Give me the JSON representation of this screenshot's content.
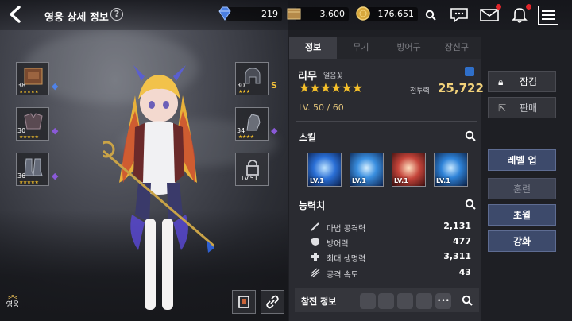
{
  "header": {
    "title": "영웅 상세 정보",
    "help": "?"
  },
  "currency": {
    "gems": "219",
    "boxes": "3,600",
    "gold": "176,651"
  },
  "equipment_slots": [
    {
      "level": "38",
      "stars": "★★★★★"
    },
    {
      "level": "30",
      "stars": "★★★★★"
    },
    {
      "level": "36",
      "stars": "★★★★★"
    },
    {
      "level": "30",
      "stars": "★★★",
      "side": "S"
    },
    {
      "level": "34",
      "stars": "★★★★"
    },
    {
      "level": "LV.51"
    }
  ],
  "bottom_left": {
    "hero_label": "영웅"
  },
  "tabs": [
    "정보",
    "무기",
    "방어구",
    "장신구"
  ],
  "hero": {
    "name": "리무",
    "subtitle": "얼음꽃",
    "stars": "★★★★★★",
    "power_label": "전투력",
    "power_value": "25,722",
    "level": "LV. 50 / 60"
  },
  "skills": {
    "title": "스킬",
    "items": [
      {
        "level": "LV.1",
        "color": "#2a6fd6"
      },
      {
        "level": "LV.1",
        "color": "#3a8fe0"
      },
      {
        "level": "LV.1",
        "color": "#c4443a"
      },
      {
        "level": "LV.1",
        "color": "#2f83d8"
      }
    ]
  },
  "stats": {
    "title": "능력치",
    "rows": [
      {
        "name": "마법 공격력",
        "value": "2,131"
      },
      {
        "name": "방어력",
        "value": "477"
      },
      {
        "name": "최대 생명력",
        "value": "3,311"
      },
      {
        "name": "공격 속도",
        "value": "43"
      }
    ]
  },
  "battle": {
    "label": "참전 정보",
    "more": "•••"
  },
  "actions": {
    "lock": "잠김",
    "sell": "판매",
    "level_up": "레벨 업",
    "train": "훈련",
    "transcend": "초월",
    "enhance": "강화"
  }
}
